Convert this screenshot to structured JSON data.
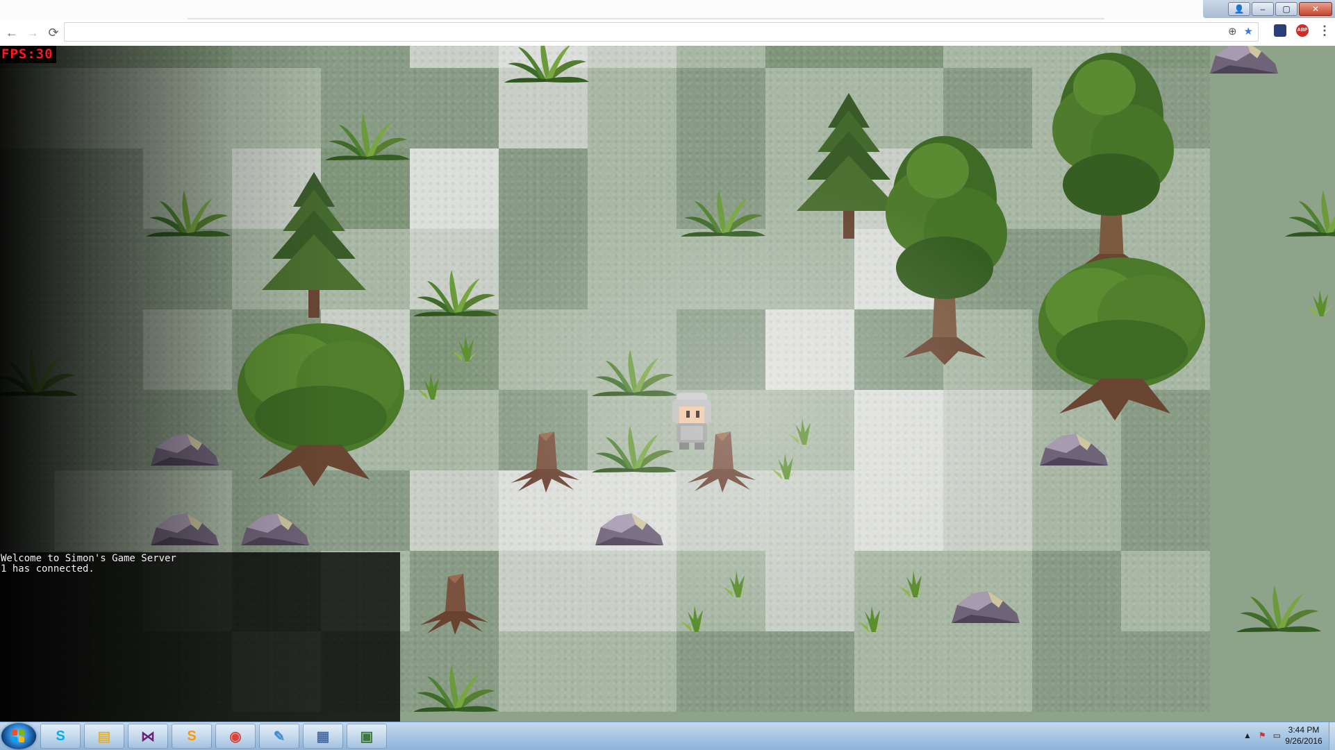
{
  "window": {
    "controls": {
      "user": "👤",
      "minimize": "–",
      "maximize": "▢",
      "close": "✕"
    }
  },
  "toolbar": {
    "back_icon": "←",
    "forward_icon": "→",
    "reload_icon": "⟳",
    "url": "",
    "zoom_icon": "⊕",
    "star_icon": "★",
    "extensions": [
      "dark-extension",
      "ABP"
    ],
    "menu_icon": "⋮"
  },
  "game": {
    "fps_label": "FPS:30",
    "console_lines": [
      "Welcome to Simon's Game Server",
      "1 has connected."
    ],
    "player": "knight-helmet-character"
  },
  "taskbar": {
    "items": [
      {
        "name": "skype",
        "glyph": "S",
        "color": "#00aff0"
      },
      {
        "name": "file-explorer",
        "glyph": "▤",
        "color": "#e2b13c"
      },
      {
        "name": "visual-studio",
        "glyph": "⋈",
        "color": "#68217a"
      },
      {
        "name": "sublime-text",
        "glyph": "S",
        "color": "#ff9800"
      },
      {
        "name": "chrome",
        "glyph": "◉",
        "color": "#db4437"
      },
      {
        "name": "notepad",
        "glyph": "✎",
        "color": "#3c8fd0"
      },
      {
        "name": "calculator",
        "glyph": "▦",
        "color": "#4a6fa5"
      },
      {
        "name": "active-window",
        "glyph": "▣",
        "color": "#3a7a3a"
      }
    ],
    "tray_icons": [
      "▲",
      "⚑",
      "▭"
    ],
    "clock_time": "3:44 PM",
    "clock_date": "9/26/2016"
  }
}
